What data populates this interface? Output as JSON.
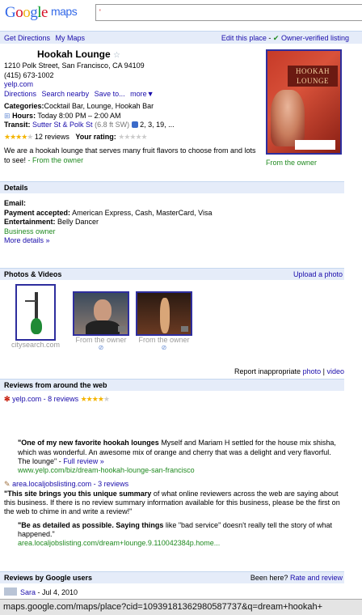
{
  "logo": {
    "g1": "G",
    "g2": "o",
    "g3": "o",
    "g4": "g",
    "g5": "l",
    "g6": "e",
    "maps": "maps"
  },
  "nav": {
    "get_directions": "Get Directions",
    "my_maps": "My Maps",
    "edit_place": "Edit this place",
    "dash": "-",
    "owner_verified": "Owner-verified listing"
  },
  "place": {
    "name": "Hookah Lounge",
    "address": "1210 Polk Street, San Francisco, CA 94109",
    "phone": "(415) 673-1002",
    "website": "yelp.com",
    "actions": [
      "Directions",
      "Search nearby",
      "Save to...",
      "more▼"
    ],
    "categories_label": "Categories:",
    "categories": "Cocktail Bar, Lounge, Hookah Bar",
    "hours_label": "Hours:",
    "hours": "Today 8:00 PM – 2:00 AM",
    "transit_label": "Transit:",
    "transit_stop": "Sutter St & Polk St",
    "transit_dist": "(6.8 ft SW)",
    "transit_lines": "2, 3, 19, ...",
    "rating": 4,
    "reviews_count": "12 reviews",
    "your_rating_label": "Your rating:",
    "description": "We are a hookah lounge that serves many fruit flavors to choose from and lots to see!",
    "from_owner": "- From the owner"
  },
  "main_photo": {
    "sign": "HOOKAH LOUNGE",
    "caption": "From the owner"
  },
  "details": {
    "header": "Details",
    "email_label": "Email:",
    "payment_label": "Payment accepted:",
    "payment": "American Express, Cash, MasterCard, Visa",
    "entertainment_label": "Entertainment:",
    "entertainment": "Belly Dancer",
    "business_owner": "Business owner",
    "more_details": "More details »"
  },
  "photos": {
    "header": "Photos & Videos",
    "upload": "Upload a photo",
    "items": [
      {
        "caption": "citysearch.com"
      },
      {
        "caption": "From the owner"
      },
      {
        "caption": "From the owner"
      }
    ],
    "report": "Report inappropriate",
    "report_photo": "photo",
    "report_sep": "|",
    "report_video": "video"
  },
  "web_reviews": {
    "header": "Reviews from around the web",
    "yelp_source": "yelp.com - 8 reviews",
    "yelp_rating": 4,
    "yelp_quote_bold": "\"One of my new favorite hookah lounges",
    "yelp_quote": "Myself and Mariam H settled for the house mix shisha, which was wonderful. An awesome mix of orange and cherry that was a delight and very flavorful. The lounge\" -",
    "full_review": "Full review »",
    "yelp_url": "www.yelp.com/biz/dream-hookah-lounge-san-francisco",
    "area_source": "area.localjobslisting.com - 3 reviews",
    "area_text_bold": "\"This site brings you this unique summary",
    "area_text": "of what online reviewers across the web are saying about this business. If there is no review summary information available for this business, please be the first on the web to chime in and write a review!\"",
    "area_quote_bold": "\"Be as detailed as possible. Saying things",
    "area_quote": "like \"bad service\" doesn't really tell the story of what happened.\"",
    "area_url": "area.localjobslisting.com/dream+lounge.9.110042384p.home..."
  },
  "google_reviews": {
    "header": "Reviews by Google users",
    "been_here": "Been here?",
    "rate_review": "Rate and review",
    "first_author": "Sara",
    "first_date": "- Jul 4, 2010"
  },
  "status_url": "maps.google.com/maps/place?cid=10939181362980587737&q=dream+hookah+"
}
